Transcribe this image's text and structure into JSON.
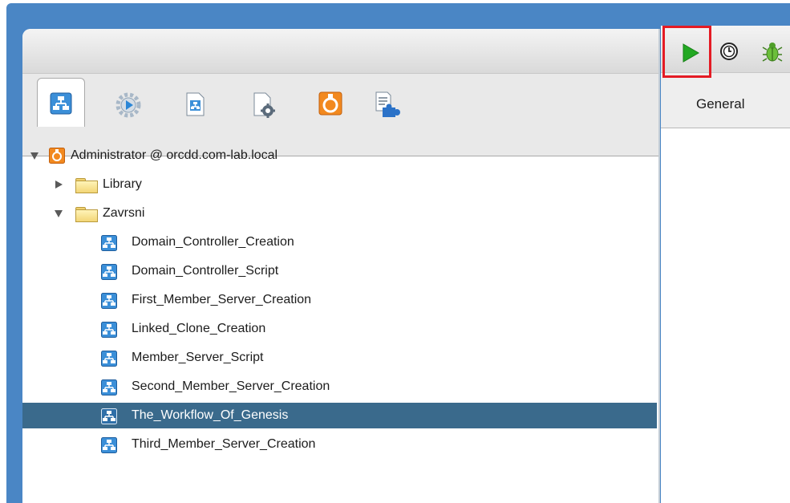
{
  "left_tabs": [
    {
      "name": "workflows",
      "icon": "workflow-icon"
    },
    {
      "name": "actions",
      "icon": "actions-gear-icon"
    },
    {
      "name": "resources",
      "icon": "resource-doc-icon"
    },
    {
      "name": "configurations",
      "icon": "config-doc-icon"
    },
    {
      "name": "packages",
      "icon": "orange-package-icon"
    },
    {
      "name": "policies",
      "icon": "policy-puzzle-icon"
    }
  ],
  "tree": {
    "root": {
      "label": "Administrator @ orcdd.com-lab.local",
      "expanded": true
    },
    "folders": [
      {
        "label": "Library",
        "expanded": false
      },
      {
        "label": "Zavrsni",
        "expanded": true
      }
    ],
    "workflows": [
      {
        "label": "Domain_Controller_Creation",
        "selected": false
      },
      {
        "label": "Domain_Controller_Script",
        "selected": false
      },
      {
        "label": "First_Member_Server_Creation",
        "selected": false
      },
      {
        "label": "Linked_Clone_Creation",
        "selected": false
      },
      {
        "label": "Member_Server_Script",
        "selected": false
      },
      {
        "label": "Second_Member_Server_Creation",
        "selected": false
      },
      {
        "label": "The_Workflow_Of_Genesis",
        "selected": true
      },
      {
        "label": "Third_Member_Server_Creation",
        "selected": false
      }
    ]
  },
  "right_toolbar": {
    "icons": [
      "run-play-icon",
      "schedule-clock-icon",
      "debug-bug-icon"
    ],
    "highlight_color": "#e41b24"
  },
  "right_tabs": {
    "general_label": "General"
  },
  "colors": {
    "frame_blue": "#4a86c5",
    "selection": "#3a6a8c",
    "play_green": "#22a822"
  }
}
